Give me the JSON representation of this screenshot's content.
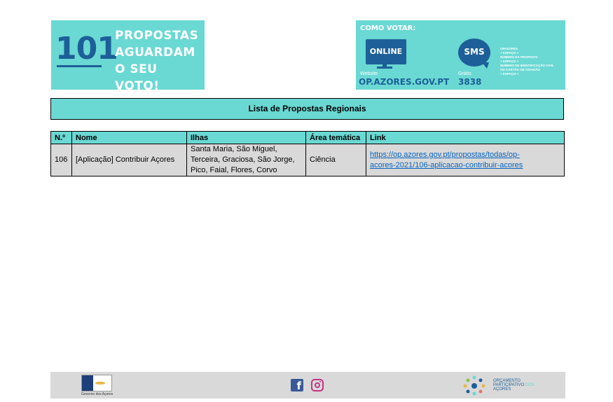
{
  "banner": {
    "number": "101",
    "line1": "PROPOSTAS",
    "line2": "AGUARDAM",
    "line3": "O SEU VOTO!"
  },
  "vote": {
    "title": "COMO VOTAR:",
    "online": "ONLINE",
    "website_label": "Website",
    "website_url": "OP.AZORES.GOV.PT",
    "sms": "SMS",
    "gratis_label": "Grátis",
    "sms_number": "3838",
    "instructions": [
      "OPAZORES",
      "+ ESPAÇO +",
      "NÚMERO DA PROPOSTA",
      "+ ESPAÇO +",
      "NÚMERO DE IDENTIFICAÇÃO CIVIL",
      "OU CARTÃO DE CIDADÃO",
      "+ ESPAÇO +"
    ]
  },
  "list_title": "Lista de Propostas Regionais",
  "table": {
    "headers": {
      "num": "N.º",
      "nome": "Nome",
      "ilhas": "Ilhas",
      "area": "Área temática",
      "link": "Link"
    },
    "rows": [
      {
        "num": "106",
        "nome": "[Aplicação] Contribuir Açores",
        "ilhas_line1": "Santa Maria, São Miguel,",
        "ilhas_line2": "Terceira, Graciosa, São Jorge,",
        "ilhas_line3": "Pico, Faial, Flores, Corvo",
        "area": "Ciência",
        "link_line1": "https://op.azores.gov.pt/propostas/todas/op-",
        "link_line2": "acores-2021/106-aplicacao-contribuir-acores"
      }
    ]
  },
  "footer": {
    "gov_label": "Governo dos Açores",
    "op_line1": "ORÇAMENTO",
    "op_line2": "PARTICIPATIVO",
    "op_dos": "DOS",
    "op_line3": "AÇORES"
  },
  "colors": {
    "accent": "#6ad8d3",
    "dark_blue": "#1d5f98",
    "row_bg": "#d9d9d9",
    "link": "#0563c1"
  }
}
